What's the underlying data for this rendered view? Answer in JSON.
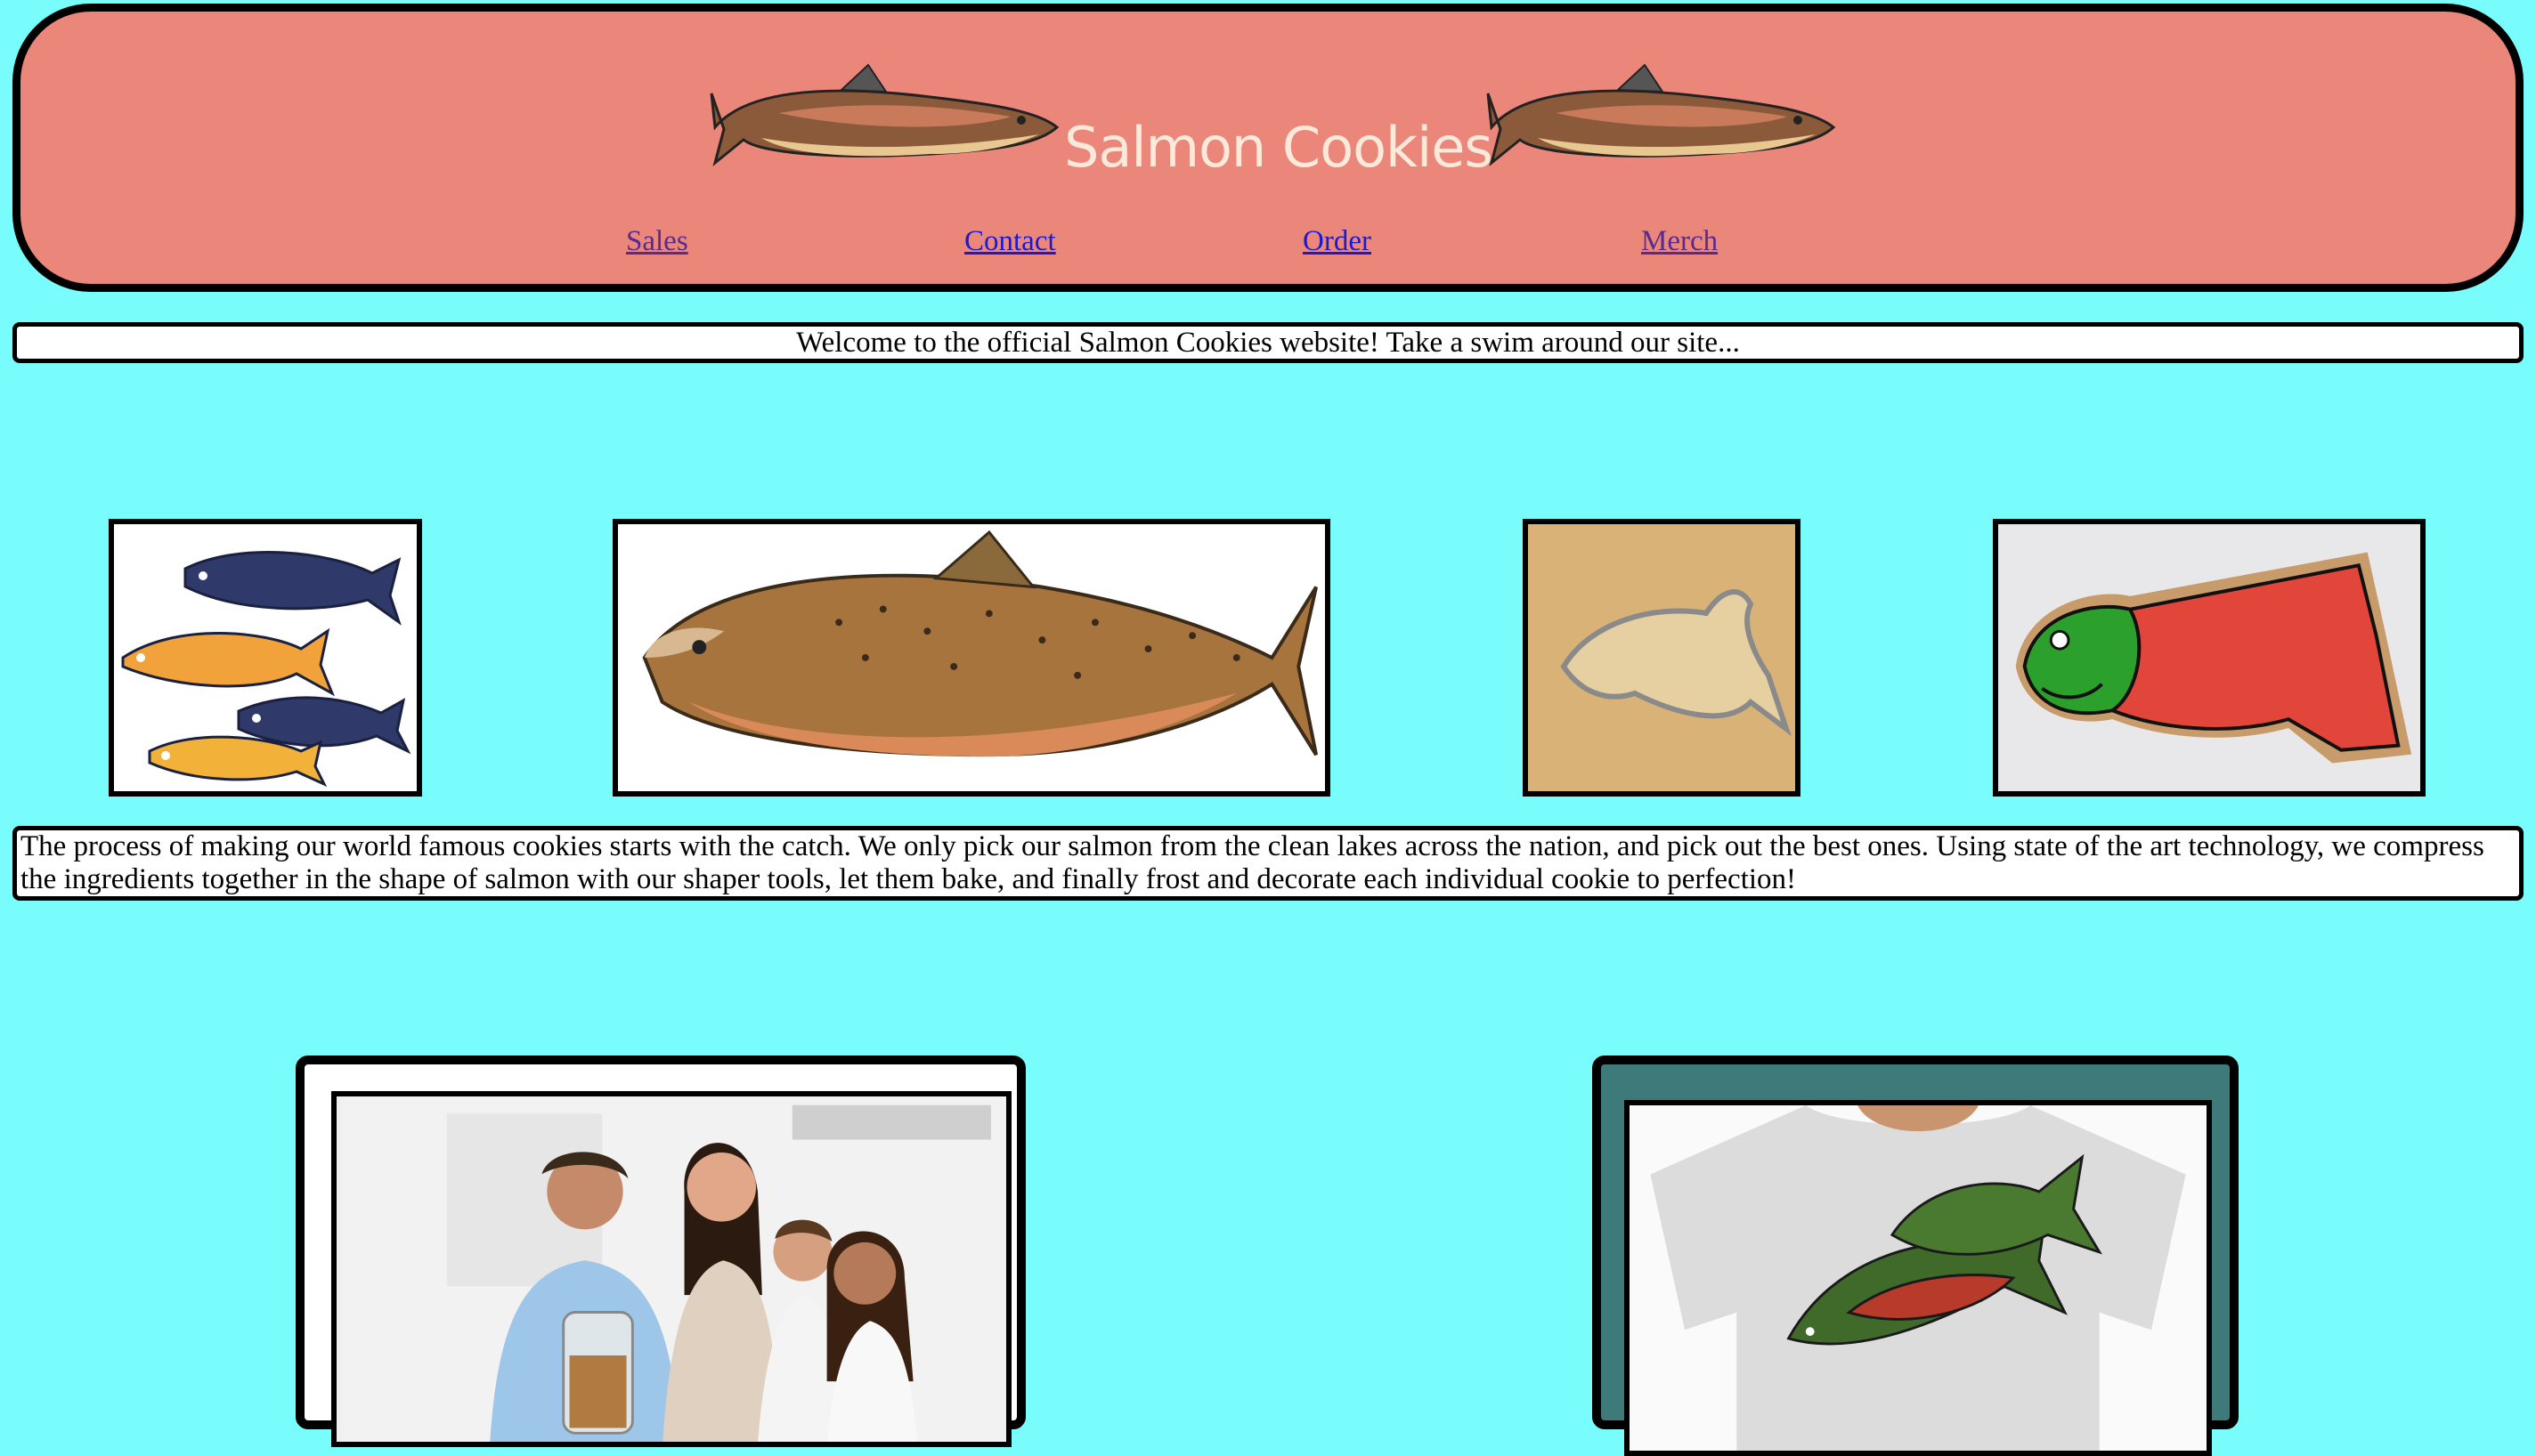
{
  "header": {
    "title": "Salmon Cookies™",
    "nav": [
      {
        "label": "Sales",
        "visited": true
      },
      {
        "label": "Contact",
        "visited": false
      },
      {
        "label": "Order",
        "visited": false
      },
      {
        "label": "Merch",
        "visited": true
      }
    ]
  },
  "welcome": {
    "text": "Welcome to the official Salmon Cookies website! Take a swim around our site..."
  },
  "process": {
    "text": "The process of making our world famous cookies starts with the catch. We only pick our salmon from the clean lakes across the nation, and pick out the best ones. Using state of the art technology, we compress the ingredients together in the shape of salmon with our shaper tools, let them bake, and finally frost and decorate each individual cookie to perfection!"
  },
  "colors": {
    "page_background": "#79fcfc",
    "header_background": "#ea877a",
    "title_text": "#fbe9da",
    "merch_card": "#3e7a7a"
  }
}
